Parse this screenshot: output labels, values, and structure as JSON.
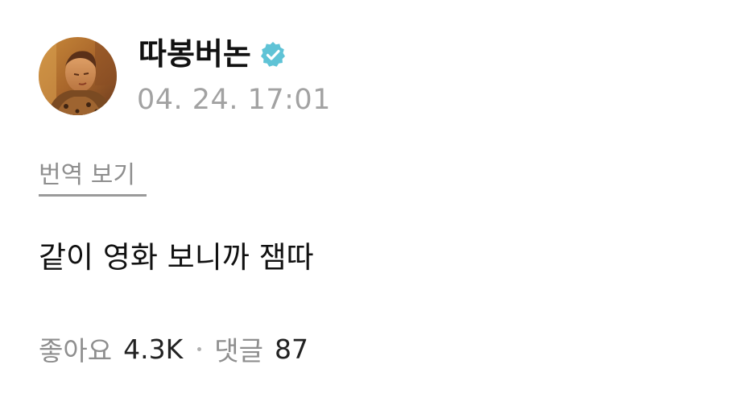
{
  "author": {
    "name": "따봉버논",
    "verified": true,
    "avatar_icon": "profile-photo-avatar"
  },
  "post": {
    "timestamp": "04. 24. 17:01",
    "translate_label": "번역 보기",
    "text": "같이 영화 보니까 잼따"
  },
  "stats": {
    "likes_label": "좋아요",
    "likes_value": "4.3K",
    "comments_label": "댓글",
    "comments_value": "87"
  },
  "colors": {
    "badge": "#5fc3d6",
    "muted_text": "#8e8e8e",
    "timestamp_text": "#a2a2a2",
    "primary_text": "#111111"
  }
}
